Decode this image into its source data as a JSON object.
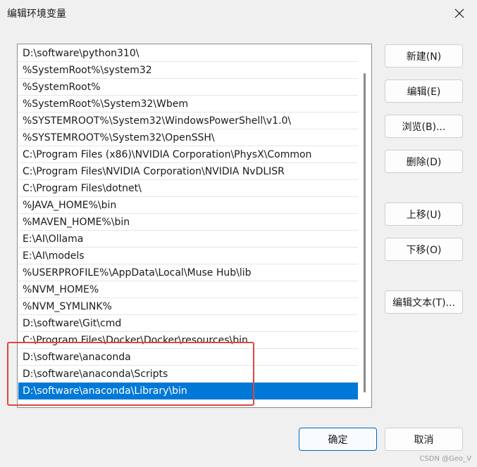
{
  "window": {
    "title": "编辑环境变量"
  },
  "path_list": {
    "items": [
      "D:\\software\\python310\\",
      "%SystemRoot%\\system32",
      "%SystemRoot%",
      "%SystemRoot%\\System32\\Wbem",
      "%SYSTEMROOT%\\System32\\WindowsPowerShell\\v1.0\\",
      "%SYSTEMROOT%\\System32\\OpenSSH\\",
      "C:\\Program Files (x86)\\NVIDIA Corporation\\PhysX\\Common",
      "C:\\Program Files\\NVIDIA Corporation\\NVIDIA NvDLISR",
      "C:\\Program Files\\dotnet\\",
      "%JAVA_HOME%\\bin",
      "%MAVEN_HOME%\\bin",
      "E:\\AI\\Ollama",
      "E:\\AI\\models",
      "%USERPROFILE%\\AppData\\Local\\Muse Hub\\lib",
      "%NVM_HOME%",
      "%NVM_SYMLINK%",
      "D:\\software\\Git\\cmd",
      "C:\\Program Files\\Docker\\Docker\\resources\\bin",
      "D:\\software\\anaconda",
      "D:\\software\\anaconda\\Scripts",
      "D:\\software\\anaconda\\Library\\bin"
    ],
    "selected_index": 20
  },
  "buttons": {
    "new": "新建(N)",
    "edit": "编辑(E)",
    "browse": "浏览(B)...",
    "delete": "删除(D)",
    "move_up": "上移(U)",
    "move_down": "下移(O)",
    "edit_text": "编辑文本(T)...",
    "ok": "确定",
    "cancel": "取消"
  },
  "colors": {
    "selection": "#0078d7",
    "highlight_box": "#e0463f"
  },
  "watermark": "CSDN @Geo_V"
}
